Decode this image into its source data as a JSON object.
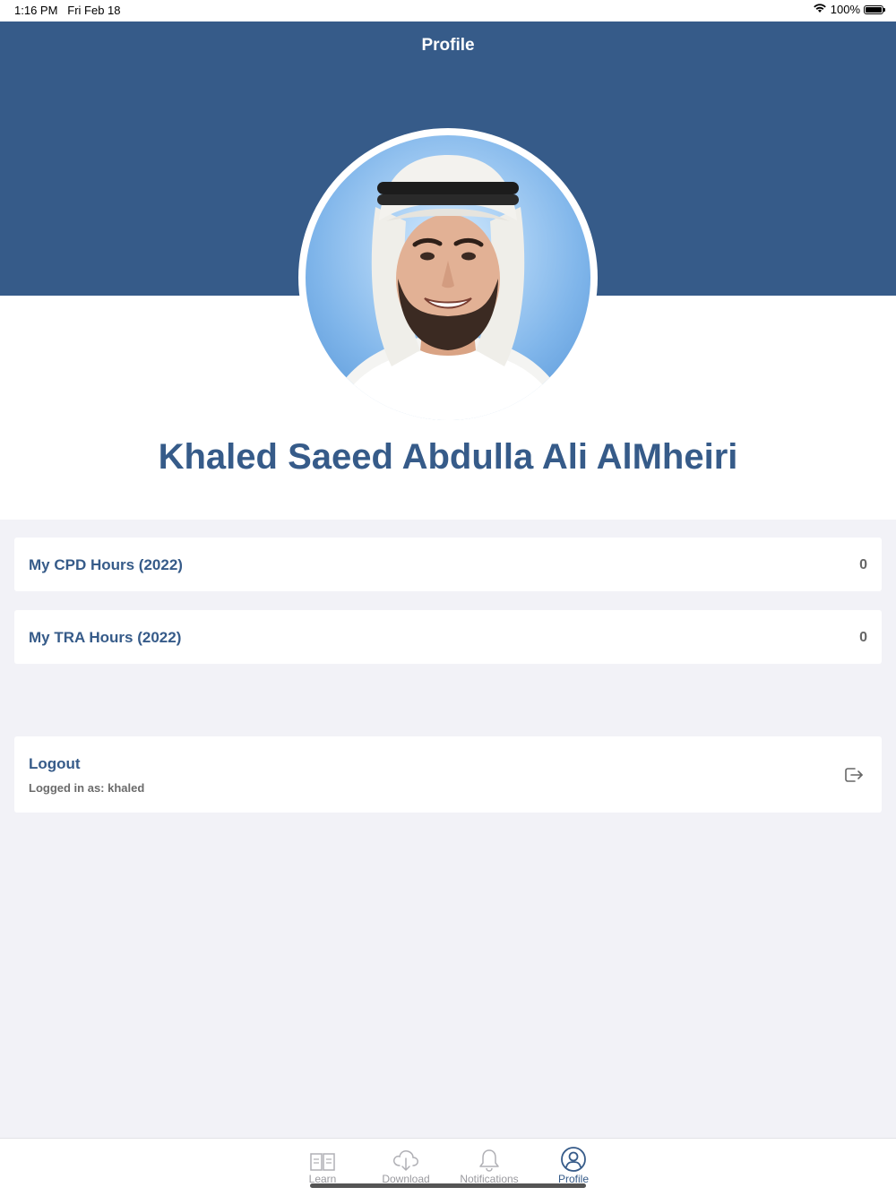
{
  "status_bar": {
    "time": "1:16 PM",
    "date": "Fri Feb 18",
    "battery": "100%"
  },
  "header": {
    "title": "Profile"
  },
  "profile": {
    "name": "Khaled Saeed Abdulla Ali AlMheiri"
  },
  "stats": [
    {
      "label": "My CPD Hours (2022)",
      "value": "0"
    },
    {
      "label": "My TRA Hours (2022)",
      "value": "0"
    }
  ],
  "logout": {
    "label": "Logout",
    "subtitle": "Logged in as: khaled",
    "icon": "logout-icon"
  },
  "tabs": [
    {
      "label": "Learn",
      "icon": "book-icon"
    },
    {
      "label": "Download",
      "icon": "cloud-download-icon"
    },
    {
      "label": "Notifications",
      "icon": "bell-icon"
    },
    {
      "label": "Profile",
      "icon": "user-circle-icon",
      "active": true
    }
  ],
  "colors": {
    "brand": "#365b89",
    "background": "#f2f2f7",
    "inactive_tab": "#9a9a9f"
  }
}
